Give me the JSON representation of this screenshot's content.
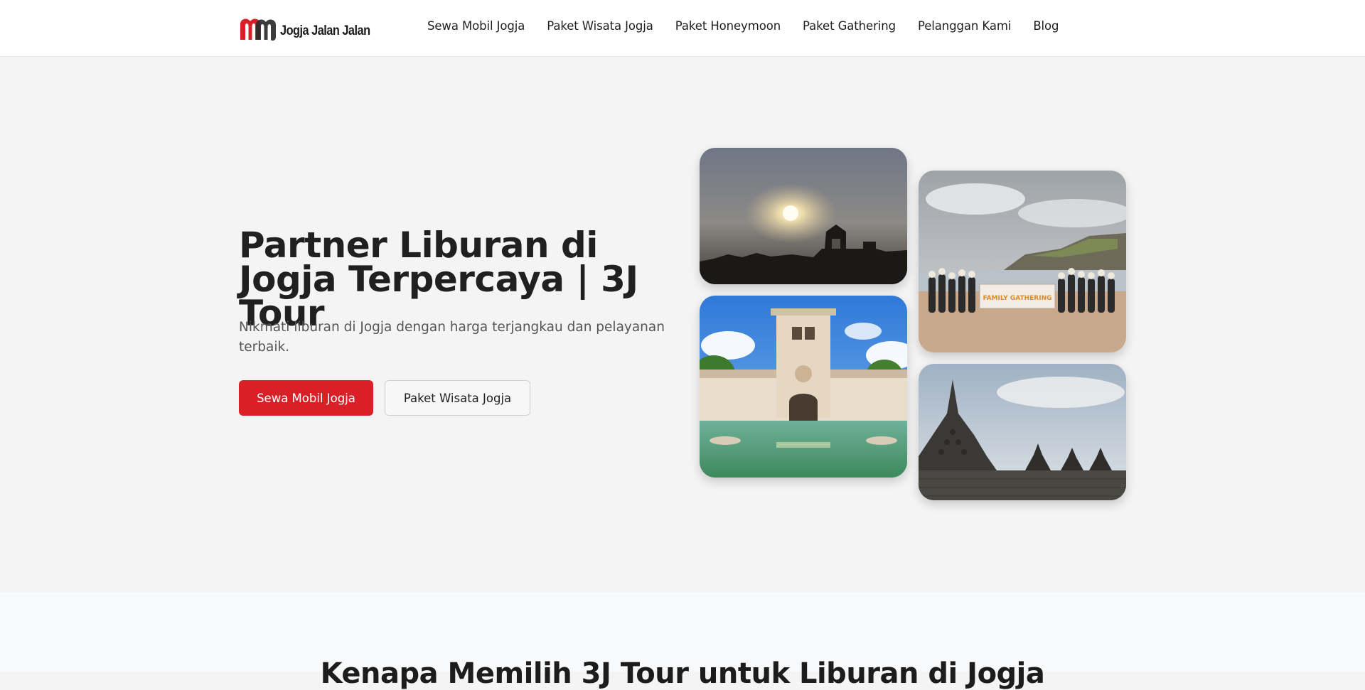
{
  "brand": {
    "name": "Jogja Jalan Jalan",
    "logo_icon": "jjj-logo-mark",
    "accent_color": "#d92026"
  },
  "nav": {
    "items": [
      {
        "label": "Sewa Mobil Jogja"
      },
      {
        "label": "Paket Wisata Jogja"
      },
      {
        "label": "Paket Honeymoon"
      },
      {
        "label": "Paket Gathering"
      },
      {
        "label": "Pelanggan Kami"
      },
      {
        "label": "Blog"
      }
    ]
  },
  "hero": {
    "title": "Partner Liburan di Jogja Terpercaya | 3J Tour",
    "subtitle": "Nikmati liburan di Jogja dengan harga terjangkau dan pelayanan terbaik.",
    "primary_button": "Sewa Mobil Jogja",
    "secondary_button": "Paket Wisata Jogja",
    "photos": [
      {
        "subject": "sunset-ratu-boko-photo"
      },
      {
        "subject": "taman-sari-water-castle-photo"
      },
      {
        "subject": "family-gathering-beach-photo",
        "banner_text": "FAMILY GATHERING"
      },
      {
        "subject": "borobudur-stupa-photo"
      }
    ]
  },
  "section2": {
    "title": "Kenapa Memilih 3J Tour untuk Liburan di Jogja"
  }
}
